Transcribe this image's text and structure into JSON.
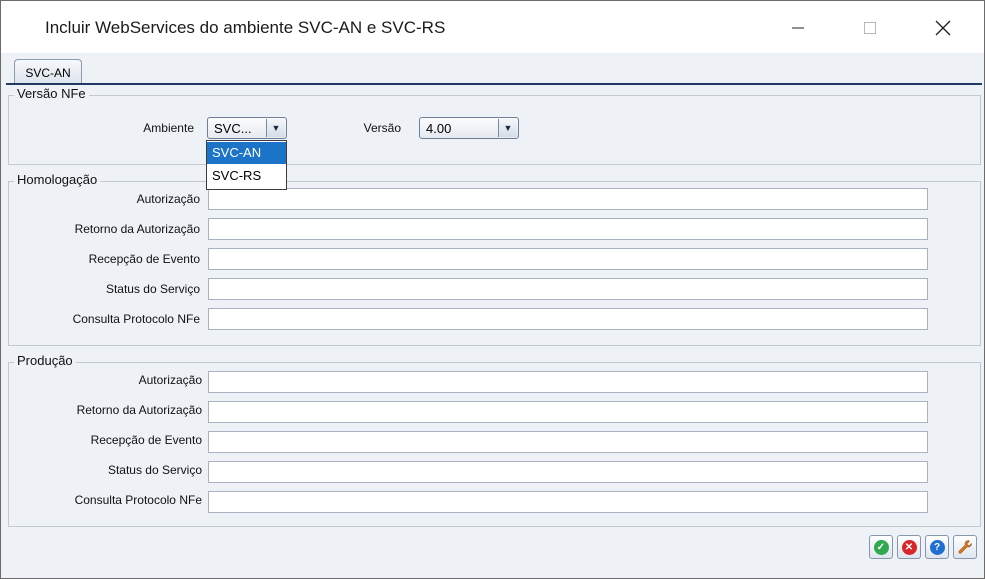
{
  "window": {
    "title": "Incluir WebServices do ambiente SVC-AN e SVC-RS"
  },
  "tabs": [
    {
      "label": "SVC-AN"
    }
  ],
  "versao_nfe": {
    "title": "Versão NFe",
    "ambiente_label": "Ambiente",
    "ambiente_value": "SVC...",
    "ambiente_options": [
      "SVC-AN",
      "SVC-RS"
    ],
    "versao_label": "Versão",
    "versao_value": "4.00"
  },
  "homologacao": {
    "title": "Homologação",
    "fields": [
      {
        "label": "Autorização",
        "value": ""
      },
      {
        "label": "Retorno da Autorização",
        "value": ""
      },
      {
        "label": "Recepção de Evento",
        "value": ""
      },
      {
        "label": "Status do Serviço",
        "value": ""
      },
      {
        "label": "Consulta Protocolo NFe",
        "value": ""
      }
    ]
  },
  "producao": {
    "title": "Produção",
    "fields": [
      {
        "label": "Autorização",
        "value": ""
      },
      {
        "label": "Retorno da Autorização",
        "value": ""
      },
      {
        "label": "Recepção de Evento",
        "value": ""
      },
      {
        "label": "Status do Serviço",
        "value": ""
      },
      {
        "label": "Consulta Protocolo NFe",
        "value": ""
      }
    ]
  },
  "colors": {
    "selection": "#1c74c9",
    "ok": "#2fa84f",
    "cancel": "#d9262b",
    "help": "#1f6fd1",
    "tool": "#e07a1f"
  },
  "icons": [
    "check-icon",
    "close-icon",
    "help-icon",
    "wrench-icon"
  ]
}
